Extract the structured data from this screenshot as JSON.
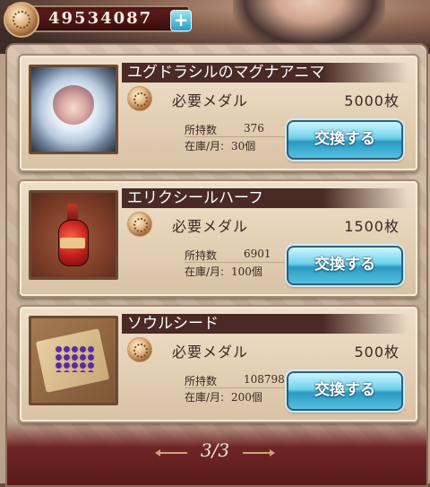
{
  "header": {
    "medal_count": "49534087",
    "plus_label": "+"
  },
  "items": [
    {
      "name": "ユグドラシルのマグナアニマ",
      "price_label": "必要メダル",
      "price_value": "5000枚",
      "owned_label": "所持数",
      "owned_value": "376",
      "stock_label": "在庫/月:",
      "stock_value": "30個",
      "button_label": "交換する"
    },
    {
      "name": "エリクシールハーフ",
      "price_label": "必要メダル",
      "price_value": "1500枚",
      "owned_label": "所持数",
      "owned_value": "6901",
      "stock_label": "在庫/月:",
      "stock_value": "100個",
      "button_label": "交換する"
    },
    {
      "name": "ソウルシード",
      "price_label": "必要メダル",
      "price_value": "500枚",
      "owned_label": "所持数",
      "owned_value": "108798",
      "stock_label": "在庫/月:",
      "stock_value": "200個",
      "button_label": "交換する"
    }
  ],
  "pager": {
    "page": "3/3"
  }
}
